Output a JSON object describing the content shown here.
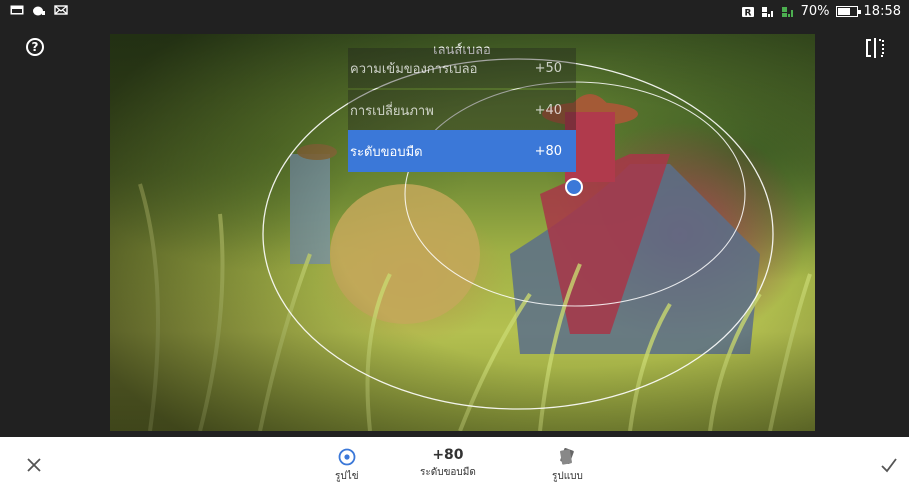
{
  "status_bar": {
    "left_icons": [
      "gallery-icon",
      "notification-icon",
      "mail-icon"
    ],
    "right_icons": [
      "sim-icon",
      "signal-icon",
      "signal-icon-2"
    ],
    "battery": "70%",
    "battery_level": 0.7,
    "time": "18:58"
  },
  "top_controls": {
    "help_glyph": "?",
    "compare_icon": "compare-icon"
  },
  "blur_menu": {
    "title": "เลนส์เบลอ",
    "items": [
      {
        "label": "ความเข้มของการเบลอ",
        "value": "+50"
      },
      {
        "label": "การเปลี่ยนภาพ",
        "value": "+40"
      },
      {
        "label": "ระดับขอบมืด",
        "value": "+80"
      }
    ],
    "selected_index": 2
  },
  "toolbar": {
    "tools": [
      {
        "label": "รูปไข่",
        "icon": "ellipse-target-icon"
      },
      {
        "value": "+80",
        "label": "ระดับขอบมืด"
      },
      {
        "label": "รูปแบบ",
        "icon": "style-cards-icon"
      }
    ],
    "close_icon": "close-icon",
    "apply_icon": "check-icon"
  },
  "colors": {
    "accent": "#3b78d8",
    "toolbar_bg": "#ffffff",
    "frame_bg": "#212121"
  }
}
